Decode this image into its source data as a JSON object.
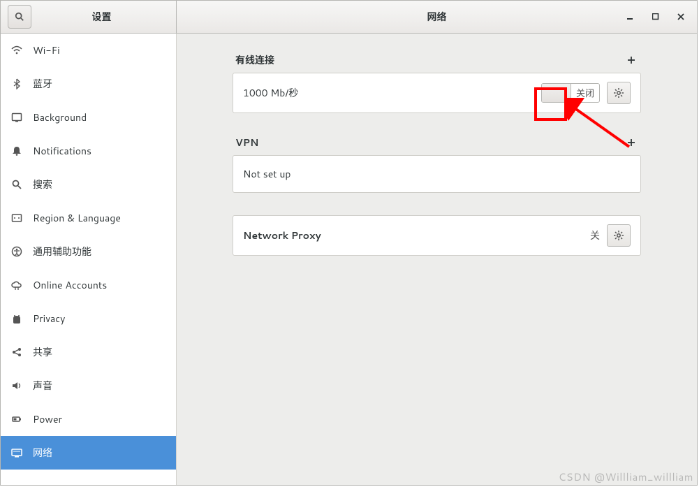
{
  "titlebar": {
    "left_title": "设置",
    "right_title": "网络"
  },
  "sidebar": {
    "items": [
      {
        "id": "wifi",
        "label": "Wi-Fi",
        "icon": "wifi-icon"
      },
      {
        "id": "bluetooth",
        "label": "蓝牙",
        "icon": "bluetooth-icon"
      },
      {
        "id": "background",
        "label": "Background",
        "icon": "background-icon"
      },
      {
        "id": "notifications",
        "label": "Notifications",
        "icon": "bell-icon"
      },
      {
        "id": "search",
        "label": "搜索",
        "icon": "search-icon"
      },
      {
        "id": "region",
        "label": "Region & Language",
        "icon": "region-icon"
      },
      {
        "id": "accessibility",
        "label": "通用辅助功能",
        "icon": "accessibility-icon"
      },
      {
        "id": "online-accounts",
        "label": "Online Accounts",
        "icon": "cloud-icon"
      },
      {
        "id": "privacy",
        "label": "Privacy",
        "icon": "privacy-icon"
      },
      {
        "id": "sharing",
        "label": "共享",
        "icon": "share-icon"
      },
      {
        "id": "sound",
        "label": "声音",
        "icon": "sound-icon"
      },
      {
        "id": "power",
        "label": "Power",
        "icon": "power-icon"
      },
      {
        "id": "network",
        "label": "网络",
        "icon": "network-icon",
        "selected": true
      }
    ]
  },
  "sections": {
    "wired": {
      "title": "有线连接",
      "connection_label": "1000 Mb/秒",
      "switch_label": "关闭"
    },
    "vpn": {
      "title": "VPN",
      "row_label": "Not set up"
    },
    "proxy": {
      "row_label": "Network Proxy",
      "status": "关"
    }
  },
  "watermark": "CSDN @Willliam_willliam"
}
